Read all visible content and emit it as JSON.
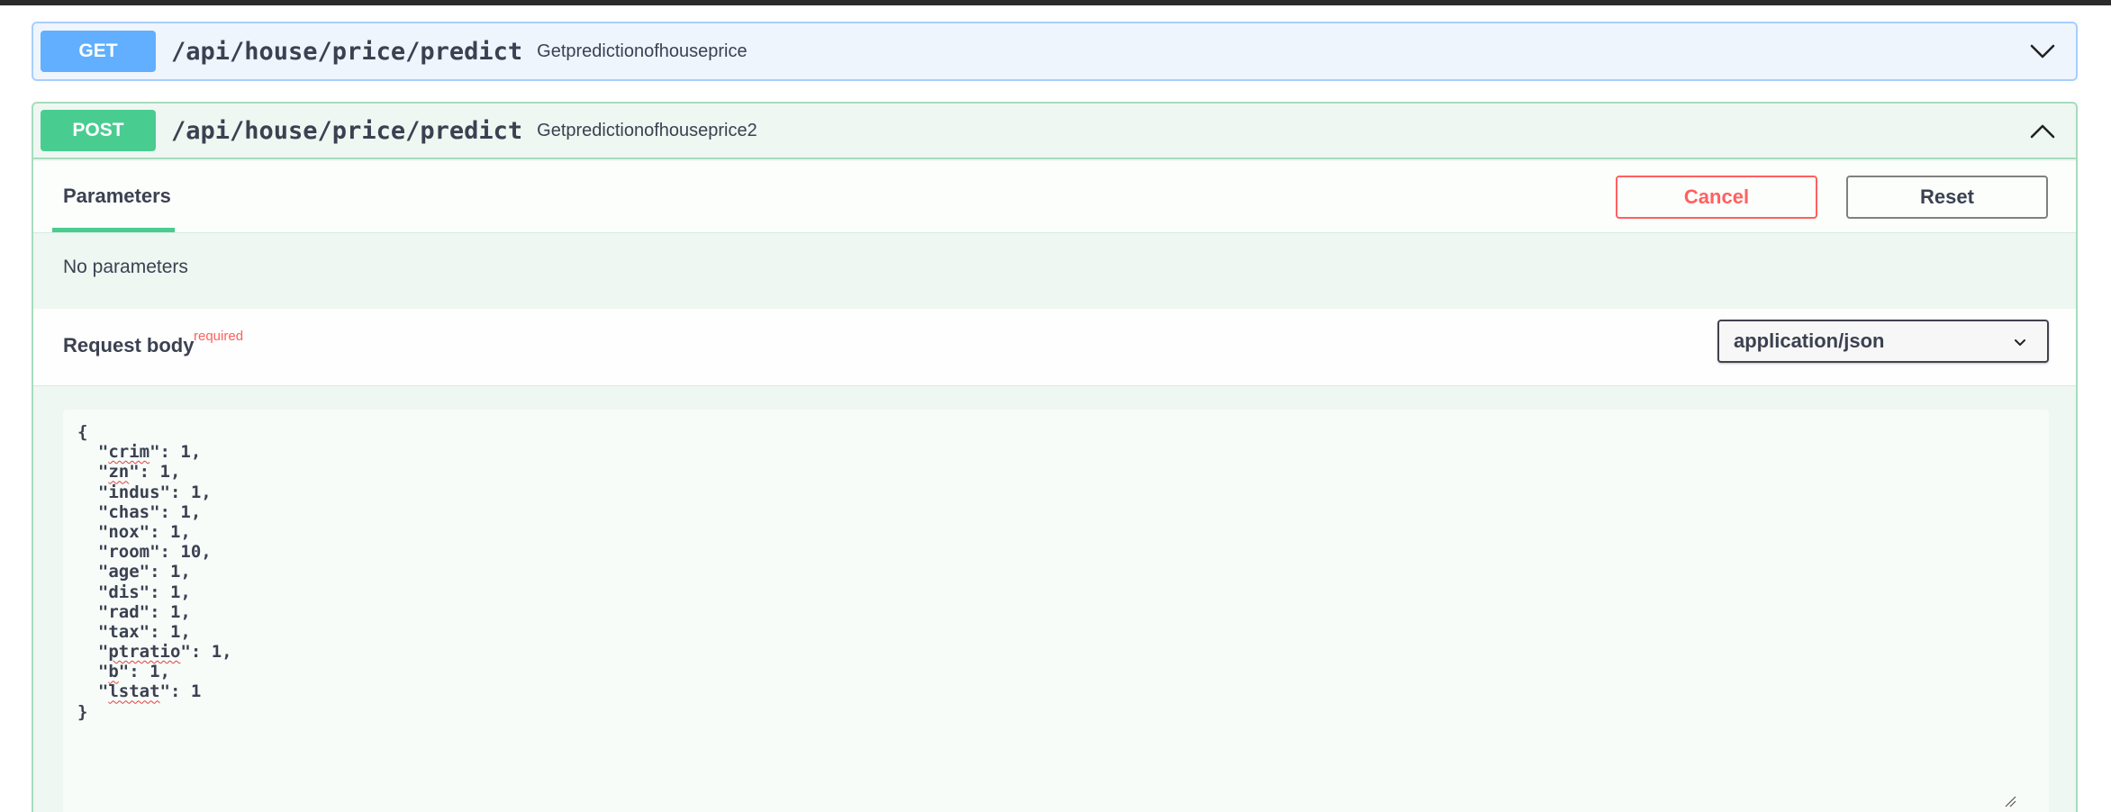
{
  "get_op": {
    "method": "GET",
    "path": "/api/house/price/predict",
    "summary": "Getpredictionofhouseprice",
    "chevron_icon": "chevron-down-icon",
    "color": "#61affe"
  },
  "post_op": {
    "method": "POST",
    "path": "/api/house/price/predict",
    "summary": "Getpredictionofhouseprice2",
    "chevron_icon": "chevron-up-icon",
    "color": "#49cc90",
    "tab_parameters": "Parameters",
    "cancel_label": "Cancel",
    "reset_label": "Reset",
    "no_parameters": "No parameters",
    "request_body_label": "Request body",
    "required_label": "required",
    "content_type": "application/json",
    "body_lines": [
      "{",
      "  \"crim\": 1,",
      "  \"zn\": 1,",
      "  \"indus\": 1,",
      "  \"chas\": 1,",
      "  \"nox\": 1,",
      "  \"room\": 10,",
      "  \"age\": 1,",
      "  \"dis\": 1,",
      "  \"rad\": 1,",
      "  \"tax\": 1,",
      "  \"ptratio\": 1,",
      "  \"b\": 1,",
      "  \"lstat\": 1",
      "}"
    ]
  },
  "colors": {
    "cancel": "#ff6060",
    "required": "#ff6060",
    "text": "#3b4151"
  }
}
